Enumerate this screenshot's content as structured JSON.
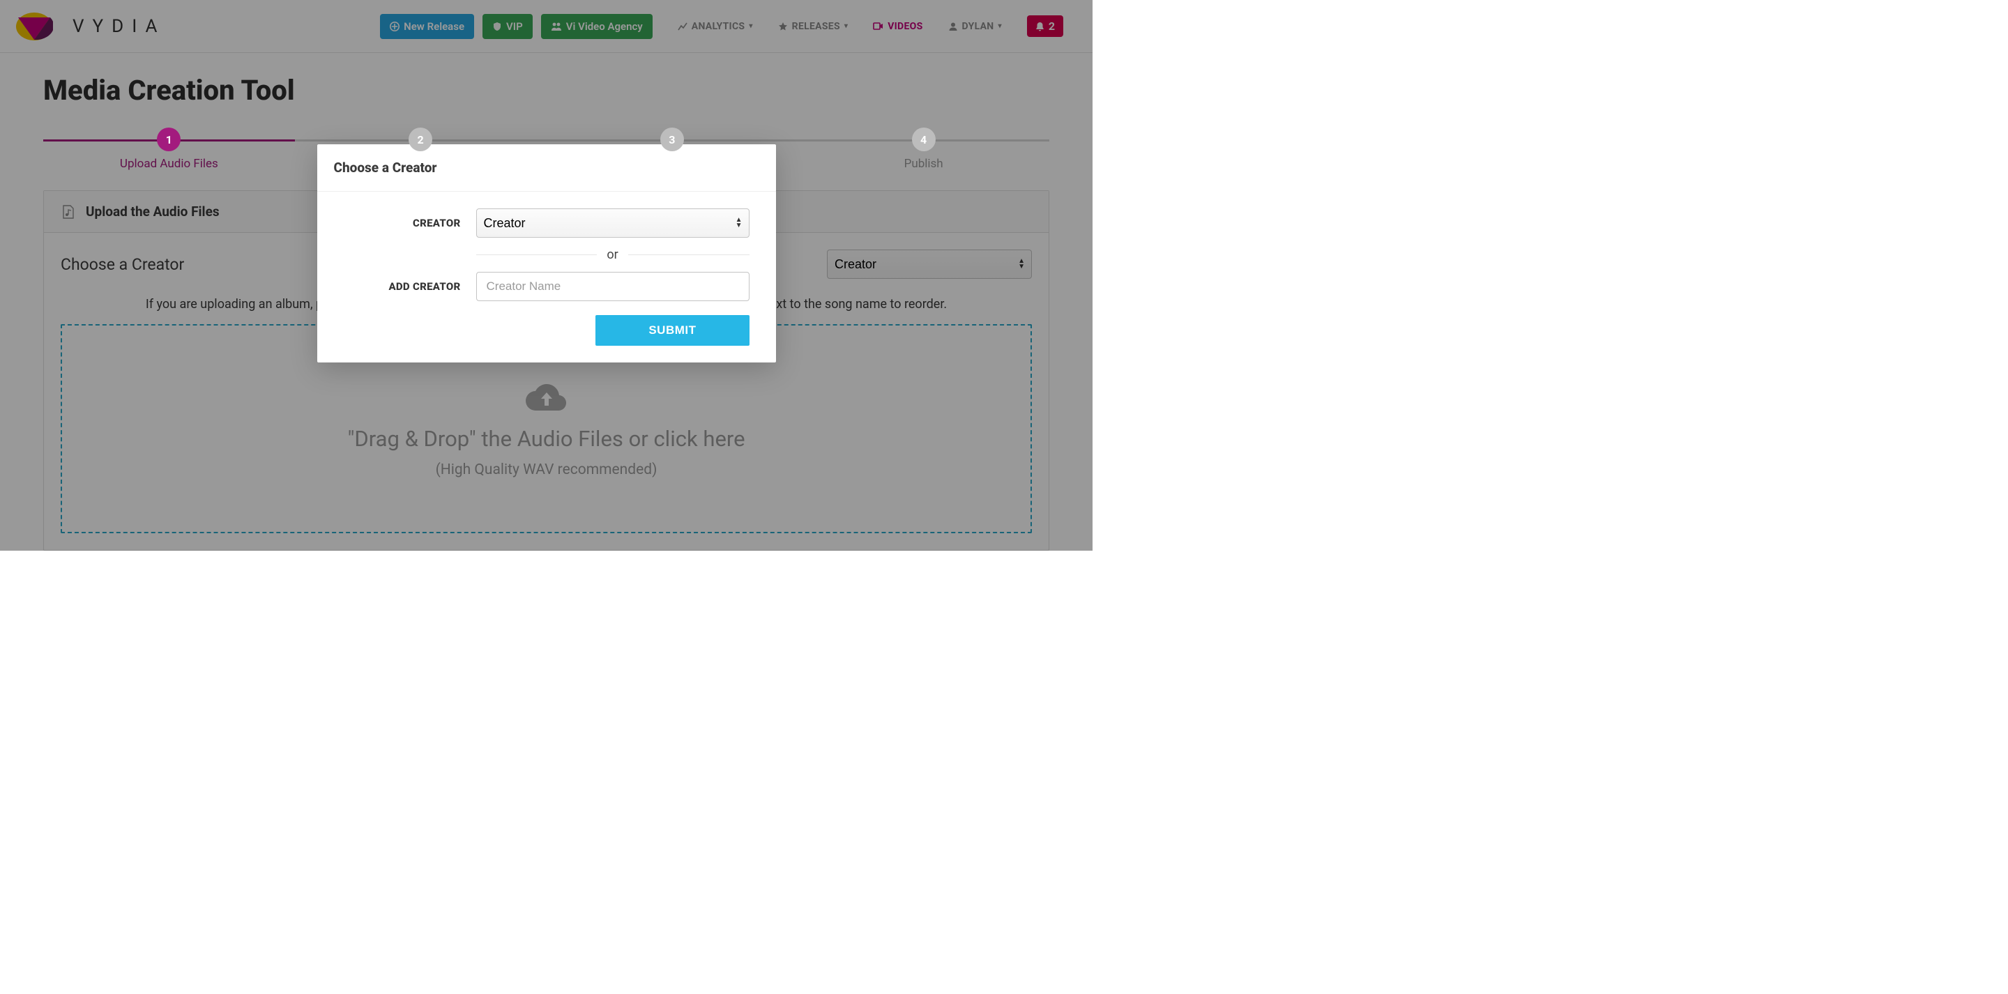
{
  "brand": {
    "name": "VYDIA"
  },
  "nav": {
    "new_release": "New Release",
    "vip": "VIP",
    "agency": "Vi Video Agency",
    "analytics": "ANALYTICS",
    "releases": "RELEASES",
    "videos": "VIDEOS",
    "user": "DYLAN",
    "notif_count": "2"
  },
  "page_title": "Media Creation Tool",
  "steps": [
    {
      "num": "1",
      "label": "Upload Audio Files"
    },
    {
      "num": "2",
      "label": ""
    },
    {
      "num": "3",
      "label": ""
    },
    {
      "num": "4",
      "label": "Publish"
    }
  ],
  "panel": {
    "header": "Upload the Audio Files",
    "choose_label": "Choose a Creator",
    "creator_selected": "Creator",
    "helper": "If you are uploading an album, please choose files in the order of the tracklisting. After uploading, drag the icon next to the song name to reorder.",
    "drop_title": "\"Drag & Drop\" the Audio Files or click here",
    "drop_sub": "(High Quality WAV recommended)"
  },
  "modal": {
    "title": "Choose a Creator",
    "creator_label": "CREATOR",
    "creator_selected": "Creator",
    "or": "or",
    "add_creator_label": "ADD CREATOR",
    "add_creator_placeholder": "Creator Name",
    "submit": "SUBMIT"
  }
}
